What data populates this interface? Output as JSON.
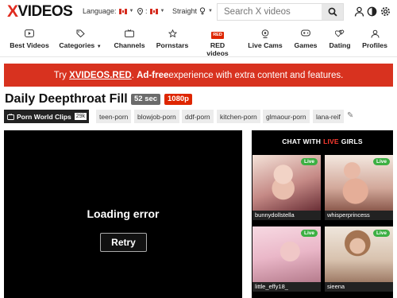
{
  "header": {
    "logo_x": "X",
    "logo_rest": "VIDEOS",
    "language_label": "Language:",
    "country_label": ":",
    "orientation_label": "Straight",
    "search_placeholder": "Search X videos"
  },
  "nav": [
    {
      "label": "Best Videos",
      "icon": "play-square-icon"
    },
    {
      "label": "Categories",
      "icon": "tags-icon"
    },
    {
      "label": "Channels",
      "icon": "tv-icon"
    },
    {
      "label": "Pornstars",
      "icon": "star-icon"
    },
    {
      "label": "RED videos",
      "icon": "red-badge-icon",
      "badge": "RED"
    },
    {
      "label": "Live Cams",
      "icon": "webcam-icon"
    },
    {
      "label": "Games",
      "icon": "gamepad-icon"
    },
    {
      "label": "Dating",
      "icon": "hearts-icon"
    },
    {
      "label": "Profiles",
      "icon": "profile-icon"
    }
  ],
  "banner": {
    "pre": "Try ",
    "brand": "XVIDEOS.RED",
    "dot": ". ",
    "bold": "Ad-free",
    "post": " experience with extra content and features."
  },
  "video": {
    "title": "Daily Deepthroat Fill",
    "duration": "52 sec",
    "quality": "1080p",
    "uploader": "Porn World Clips",
    "uploader_count": "29k",
    "tags": [
      "teen-porn",
      "blowjob-porn",
      "ddf-porn",
      "kitchen-porn",
      "glmaour-porn",
      "lana-reif"
    ]
  },
  "player": {
    "error_text": "Loading error",
    "retry_label": "Retry"
  },
  "cams": {
    "title_pre": "CHAT WITH",
    "title_live": "LIVE",
    "title_post": "GIRLS",
    "live_badge": "Live",
    "items": [
      {
        "name": "bunnydollstella"
      },
      {
        "name": "whisperprincess"
      },
      {
        "name": "little_effy18_"
      },
      {
        "name": "sieena"
      }
    ]
  },
  "colors": {
    "accent": "#d8321f",
    "hd_badge": "#de2600",
    "live_badge": "#3cb043"
  }
}
